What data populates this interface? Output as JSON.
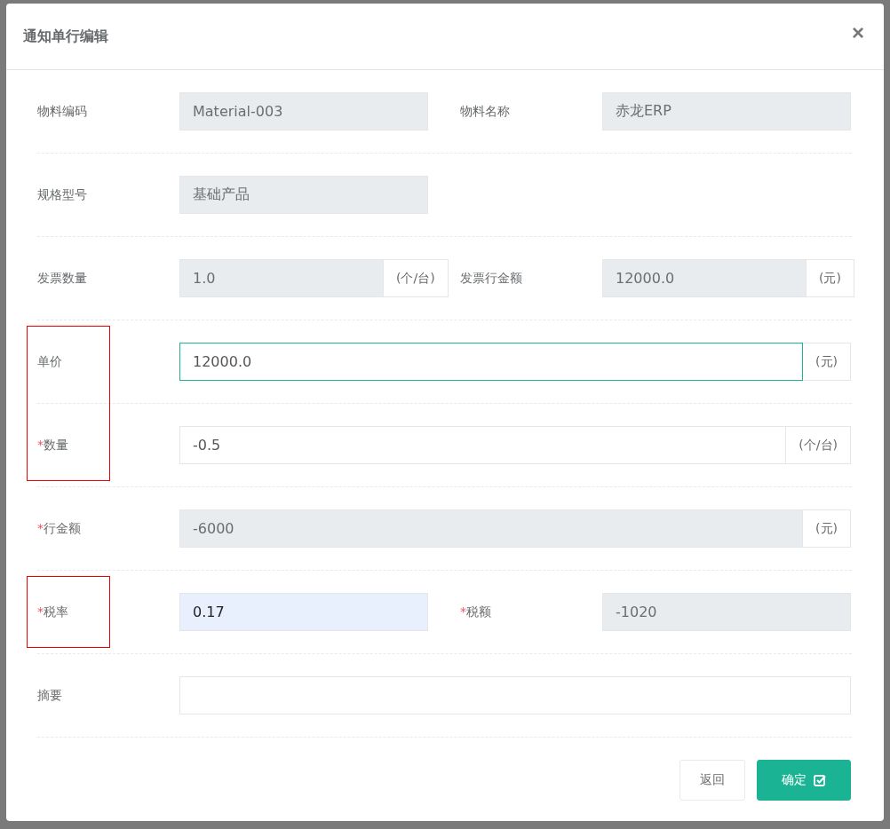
{
  "dialog": {
    "title": "通知单行编辑",
    "close": "×"
  },
  "rows": [
    {
      "fields": [
        {
          "label": "物料编码",
          "highlighted": false,
          "value": "Material-003",
          "disabled": true,
          "focused": false,
          "autofilled": false,
          "wide": false
        },
        {
          "label": "物料名称",
          "highlighted": false,
          "value": "赤龙ERP",
          "disabled": true,
          "focused": false,
          "autofilled": false,
          "wide": false
        }
      ]
    },
    {
      "fields": [
        {
          "label": "规格型号",
          "highlighted": false,
          "value": "基础产品",
          "disabled": true,
          "focused": false,
          "autofilled": false,
          "wide": false
        }
      ]
    },
    {
      "fields": [
        {
          "label": "发票数量",
          "highlighted": false,
          "value": "1.0",
          "unit": "(个/台)",
          "disabled": true,
          "focused": false,
          "autofilled": false,
          "wide": false
        },
        {
          "label": "发票行金额",
          "highlighted": false,
          "value": "12000.0",
          "unit": "(元)",
          "disabled": true,
          "focused": false,
          "autofilled": false,
          "wide": false
        }
      ]
    },
    {
      "fields": [
        {
          "label": "单价",
          "highlighted": true,
          "value": "12000.0",
          "unit": "(元)",
          "disabled": false,
          "focused": true,
          "autofilled": false,
          "wide": true
        }
      ]
    },
    {
      "fields": [
        {
          "required_mark": "*",
          "label": "数量",
          "highlighted": true,
          "value": "-0.5",
          "unit": "(个/台)",
          "disabled": false,
          "focused": false,
          "autofilled": false,
          "wide": true
        }
      ]
    },
    {
      "fields": [
        {
          "required_mark": "*",
          "label": "行金额",
          "highlighted": false,
          "value": "-6000",
          "unit": "(元)",
          "disabled": true,
          "focused": false,
          "autofilled": false,
          "wide": true
        }
      ]
    },
    {
      "fields": [
        {
          "required_mark": "*",
          "label": "税率",
          "highlighted": true,
          "value": "0.17",
          "disabled": false,
          "focused": false,
          "autofilled": true,
          "wide": false
        },
        {
          "required_mark": "*",
          "label": "税额",
          "highlighted": false,
          "value": "-1020",
          "disabled": true,
          "focused": false,
          "autofilled": false,
          "wide": false
        }
      ]
    },
    {
      "fields": [
        {
          "label": "摘要",
          "highlighted": false,
          "disabled": false,
          "focused": false,
          "autofilled": false,
          "wide": true
        }
      ]
    }
  ],
  "buttons": [
    {
      "label": "返回",
      "kind": "secondary"
    },
    {
      "label": "确定",
      "kind": "primary"
    }
  ]
}
